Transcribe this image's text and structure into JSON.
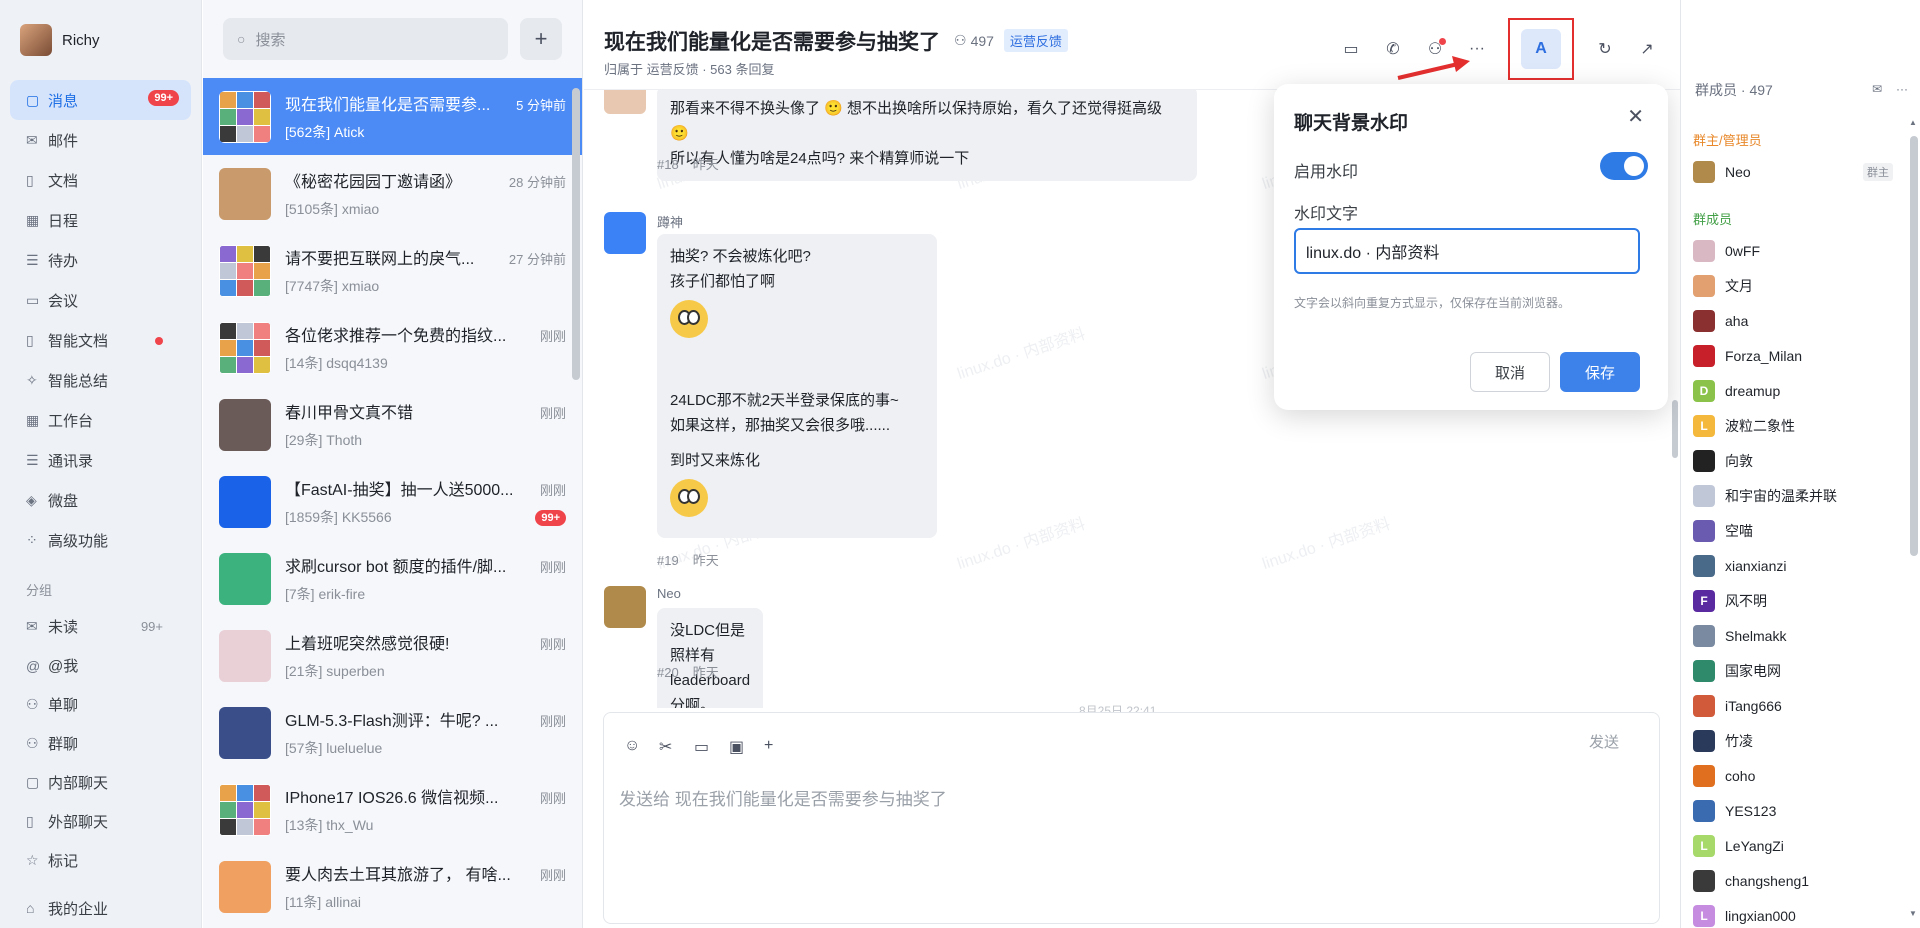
{
  "user": {
    "name": "Richy"
  },
  "nav": {
    "items": [
      {
        "label": "消息",
        "icon": "chat-icon",
        "badge": "99+",
        "active": true
      },
      {
        "label": "邮件",
        "icon": "mail-icon"
      },
      {
        "label": "文档",
        "icon": "document-icon"
      },
      {
        "label": "日程",
        "icon": "calendar-icon"
      },
      {
        "label": "待办",
        "icon": "todo-icon"
      },
      {
        "label": "会议",
        "icon": "video-icon"
      },
      {
        "label": "智能文档",
        "icon": "smart-doc-icon",
        "dot": true
      },
      {
        "label": "智能总结",
        "icon": "sparkle-icon"
      },
      {
        "label": "工作台",
        "icon": "grid-icon"
      },
      {
        "label": "通讯录",
        "icon": "contacts-icon"
      },
      {
        "label": "微盘",
        "icon": "drive-icon"
      },
      {
        "label": "高级功能",
        "icon": "apps-icon"
      }
    ],
    "group_section": "分组",
    "groups": [
      {
        "label": "未读",
        "icon": "mail-icon",
        "count": "99+"
      },
      {
        "label": "@我",
        "icon": "at-icon"
      },
      {
        "label": "单聊",
        "icon": "people-icon"
      },
      {
        "label": "群聊",
        "icon": "people-icon"
      },
      {
        "label": "内部聊天",
        "icon": "chat-icon"
      },
      {
        "label": "外部聊天",
        "icon": "document-icon"
      },
      {
        "label": "标记",
        "icon": "star-icon"
      }
    ],
    "enterprise": "我的企业"
  },
  "convs": {
    "search_placeholder": "搜索",
    "add": "+",
    "items": [
      {
        "title": "现在我们能量化是否需要参...",
        "time": "5 分钟前",
        "sub": "[562条] Atick",
        "active": true,
        "av": "grid"
      },
      {
        "title": "《秘密花园园丁邀请函》",
        "time": "28 分钟前",
        "sub": "[5105条] xmiao",
        "av": "#c99a6b"
      },
      {
        "title": "请不要把互联网上的戾气...",
        "time": "27 分钟前",
        "sub": "[7747条] xmiao",
        "av": "grid"
      },
      {
        "title": "各位佬求推荐一个免费的指纹...",
        "time": "刚刚",
        "sub": "[14条] dsqq4139",
        "av": "grid"
      },
      {
        "title": "春川甲骨文真不错",
        "time": "刚刚",
        "sub": "[29条] Thoth",
        "av": "#6a5a58"
      },
      {
        "title": "【FastAI-抽奖】抽一人送5000...",
        "time": "刚刚",
        "sub": "[1859条] KK5566",
        "badge": "99+",
        "av": "#1a63e8"
      },
      {
        "title": "求刷cursor bot 额度的插件/脚...",
        "time": "刚刚",
        "sub": "[7条] erik-fire",
        "av": "#3cb37f"
      },
      {
        "title": "上着班呢突然感觉很硬!",
        "time": "刚刚",
        "sub": "[21条] superben",
        "av": "#e8d0d6"
      },
      {
        "title": "GLM-5.3-Flash测评：牛呢? ...",
        "time": "刚刚",
        "sub": "[57条] lueluelue",
        "av": "#3a4f8a"
      },
      {
        "title": "IPhone17 IOS26.6 微信视频...",
        "time": "刚刚",
        "sub": "[13条] thx_Wu",
        "av": "grid"
      },
      {
        "title": "要人肉去土耳其旅游了， 有啥...",
        "time": "刚刚",
        "sub": "[11条] allinai",
        "av": "#f0a060"
      }
    ]
  },
  "chat": {
    "title": "现在我们能量化是否需要参与抽奖了",
    "member_count": "497",
    "tag": "运营反馈",
    "sub": "归属于 运营反馈 · 563 条回复",
    "watermark": "linux.do · 内部资料",
    "messages": [
      {
        "lines": [
          "那看来不得不换头像了 🙂 想不出换啥所以保持原始，看久了还觉得挺高级 🙂",
          "所以有人懂为啥是24点吗? 来个精算师说一下"
        ],
        "num": "#18",
        "time": "昨天"
      },
      {
        "name": "蹲神",
        "lines": [
          "抽奖? 不会被炼化吧?",
          "孩子们都怕了啊"
        ],
        "lines2": [
          "24LDC那不就2天半登录保底的事~",
          "如果这样，那抽奖又会很多哦......"
        ],
        "lines3": [
          "到时又来炼化"
        ],
        "num": "#19",
        "time": "昨天"
      },
      {
        "name": "Neo",
        "lines": [
          "没LDC但是照样有 leaderboard 分啊。"
        ],
        "num": "#20",
        "time": "昨天"
      }
    ],
    "peek_time": "8月25日 22:41",
    "composer": {
      "placeholder": "发送给 现在我们能量化是否需要参与抽奖了",
      "send": "发送"
    }
  },
  "popup": {
    "title": "聊天背景水印",
    "enable_label": "启用水印",
    "enabled": true,
    "text_label": "水印文字",
    "text_value": "linux.do · 内部资料",
    "hint": "文字会以斜向重复方式显示，仅保存在当前浏览器。",
    "cancel": "取消",
    "save": "保存"
  },
  "members": {
    "header": "群成员 · 497",
    "admin_section": "群主/管理员",
    "member_section": "群成员",
    "admins": [
      {
        "name": "Neo",
        "role": "群主",
        "color": "#b08a4a"
      }
    ],
    "items": [
      {
        "name": "0wFF",
        "color": "#d9b8c4"
      },
      {
        "name": "文月",
        "color": "#e2a070"
      },
      {
        "name": "aha",
        "color": "#8a3030"
      },
      {
        "name": "Forza_Milan",
        "color": "#c8202a"
      },
      {
        "name": "dreamup",
        "color": "#8bc34a",
        "letter": "D"
      },
      {
        "name": "波粒二象性",
        "color": "#f4b83c",
        "letter": "L"
      },
      {
        "name": "向敦",
        "color": "#222222"
      },
      {
        "name": "和宇宙的温柔并联",
        "color": "#c0c8d8"
      },
      {
        "name": "空喵",
        "color": "#6a5ab0"
      },
      {
        "name": "xianxianzi",
        "color": "#4a6a8a"
      },
      {
        "name": "风不明",
        "color": "#5a2aa0",
        "letter": "F"
      },
      {
        "name": "Shelmakk",
        "color": "#7a8aa0"
      },
      {
        "name": "国家电网",
        "color": "#2e8a6a"
      },
      {
        "name": "iTang666",
        "color": "#d05a3a"
      },
      {
        "name": "竹凌",
        "color": "#2a3a5a"
      },
      {
        "name": "coho",
        "color": "#e07020"
      },
      {
        "name": "YES123",
        "color": "#3a6ab0"
      },
      {
        "name": "LeYangZi",
        "color": "#a6d96a",
        "letter": "L"
      },
      {
        "name": "changsheng1",
        "color": "#3a3a3a"
      },
      {
        "name": "lingxian000",
        "color": "#c58ce0",
        "letter": "L"
      }
    ]
  }
}
